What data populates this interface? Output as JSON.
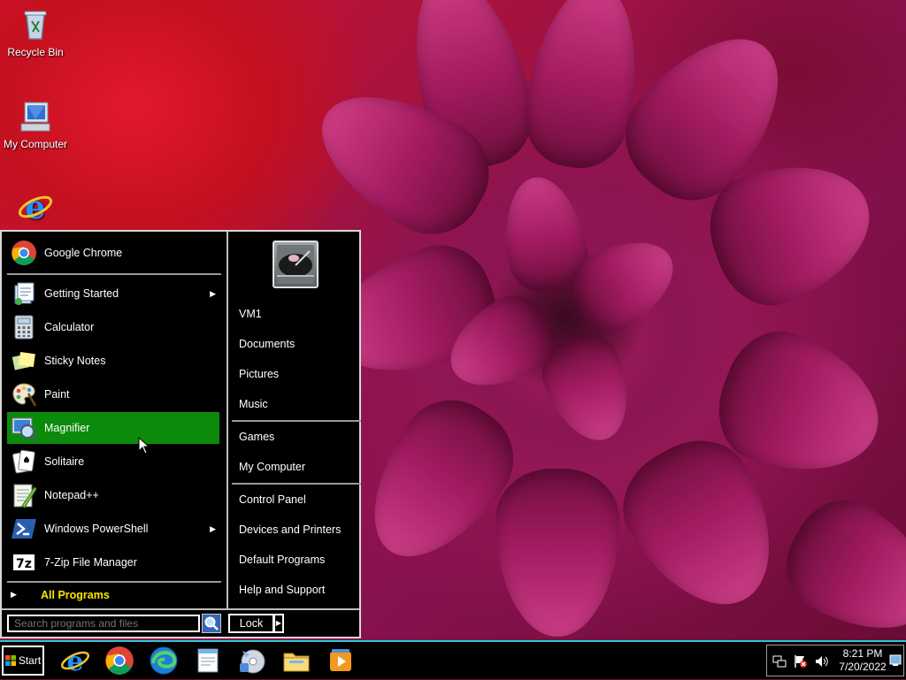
{
  "desktop": {
    "icons": [
      {
        "label": "Recycle Bin",
        "icon": "recycle-bin-icon"
      },
      {
        "label": "My Computer",
        "icon": "computer-icon"
      },
      {
        "label": "",
        "icon": "internet-explorer-icon"
      }
    ]
  },
  "start_menu": {
    "pinned": [
      {
        "label": "Google Chrome",
        "icon": "chrome-icon"
      }
    ],
    "programs": [
      {
        "label": "Getting Started",
        "icon": "getting-started-icon",
        "submenu": true
      },
      {
        "label": "Calculator",
        "icon": "calculator-icon",
        "submenu": false
      },
      {
        "label": "Sticky Notes",
        "icon": "sticky-notes-icon",
        "submenu": false
      },
      {
        "label": "Paint",
        "icon": "paint-palette-icon",
        "submenu": false
      },
      {
        "label": "Magnifier",
        "icon": "magnifier-icon",
        "submenu": false,
        "highlighted": true
      },
      {
        "label": "Solitaire",
        "icon": "solitaire-icon",
        "submenu": false
      },
      {
        "label": "Notepad++",
        "icon": "notepadpp-icon",
        "submenu": false
      },
      {
        "label": "Windows PowerShell",
        "icon": "powershell-icon",
        "submenu": true
      },
      {
        "label": "7-Zip File Manager",
        "icon": "7zip-icon",
        "submenu": false
      }
    ],
    "all_programs": "All Programs",
    "right_pane": {
      "group1": [
        "VM1",
        "Documents",
        "Pictures",
        "Music"
      ],
      "group2": [
        "Games",
        "My Computer"
      ],
      "group3": [
        "Control Panel",
        "Devices and Printers",
        "Default Programs",
        "Help and Support"
      ]
    },
    "search": {
      "placeholder": "Search programs and files"
    },
    "lock_label": "Lock"
  },
  "taskbar": {
    "start_label": "Start",
    "apps": [
      "internet-explorer-icon",
      "chrome-icon",
      "edge-icon",
      "notepad-icon",
      "media-center-icon",
      "file-explorer-icon",
      "media-player-icon"
    ],
    "tray_icons": [
      "network-icon",
      "action-center-flag-icon",
      "volume-icon"
    ],
    "time": "8:21 PM",
    "date": "7/20/2022"
  },
  "colors": {
    "highlight": "#0c8a0c",
    "all_programs_text": "#ffe500",
    "taskbar_border": "#2cc7d3"
  }
}
